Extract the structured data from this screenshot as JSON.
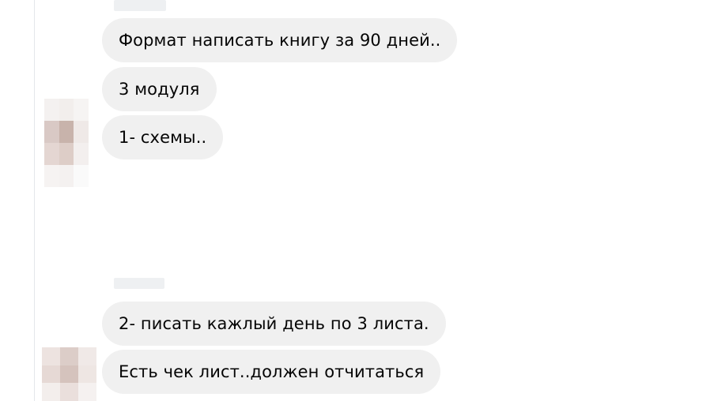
{
  "conversation": {
    "messages": [
      {
        "text": "Формат написать книгу за 90 дней.."
      },
      {
        "text": "3 модуля"
      },
      {
        "text": "1- схемы.."
      },
      {
        "text": "2- писать кажлый день по 3 листа."
      },
      {
        "text": "Есть чек лист..должен отчитаться"
      }
    ]
  },
  "colors": {
    "bubble_background": "#f0f0f0",
    "text": "#050505",
    "divider": "#e4e6eb"
  },
  "icons": {
    "avatar": "pixelated-avatar"
  }
}
